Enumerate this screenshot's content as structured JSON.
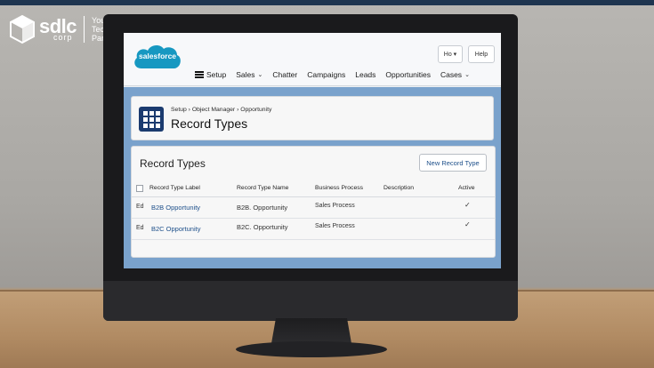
{
  "brand": {
    "name": "sdlc",
    "sub": "corp",
    "tagline_1": "Your",
    "tagline_2": "Technology",
    "tagline_3": "Partner"
  },
  "header": {
    "logo_text": "salesforce",
    "user_button": "Ho ▾",
    "help_button": "Help",
    "nav": [
      {
        "label": "Setup",
        "chevron": ""
      },
      {
        "label": "Sales",
        "chevron": "⌄"
      },
      {
        "label": "Chatter",
        "chevron": ""
      },
      {
        "label": "Campaigns",
        "chevron": ""
      },
      {
        "label": "Leads",
        "chevron": ""
      },
      {
        "label": "Opportunities",
        "chevron": ""
      },
      {
        "label": "Cases",
        "chevron": "⌄"
      }
    ]
  },
  "breadcrumb": {
    "part1": "Setup",
    "sep": "›",
    "part2": "Object Manager",
    "part3": "Opportunity"
  },
  "page_title": "Record Types",
  "list": {
    "title": "Record Types",
    "new_button": "New Record Type",
    "columns": [
      "Record Type Label",
      "Record Type Name",
      "Business Process",
      "Description",
      "Active"
    ],
    "rows": [
      {
        "action": "Ed",
        "label": "B2B Opportunity",
        "name": "B2B. Opportunity",
        "process": "Sales Process",
        "description": "",
        "active": "✓"
      },
      {
        "action": "Ed",
        "label": "B2C Opportunity",
        "name": "B2C. Opportunity",
        "process": "Sales Process",
        "description": "",
        "active": "✓"
      }
    ]
  },
  "colors": {
    "accent": "#1d4f8a",
    "salesforce_blue": "#1798c1",
    "icon_navy": "#1b3b6f"
  }
}
